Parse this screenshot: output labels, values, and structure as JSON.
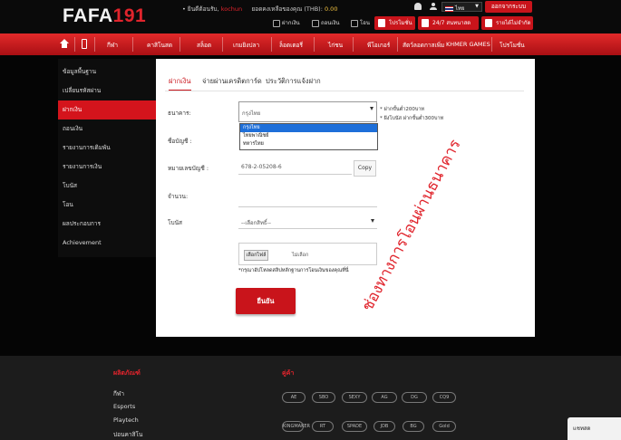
{
  "header": {
    "logo_white": "FAFA",
    "logo_red": "191",
    "welcome_prefix": "• ยินดีต้อนรับ,",
    "username": "kochun",
    "balance_label": "ยอดคงเหลือของคุณ (THB):",
    "balance_value": "0.00",
    "links": {
      "deposit": "ฝากเงิน",
      "withdraw": "ถอนเงิน",
      "transfer": "โอน"
    },
    "language": "ไทย",
    "logout": "ออกจากระบบ",
    "btn_promo": "โปรโมชั่น",
    "btn_support": "24/7 สนทนาสด",
    "btn_affiliate": "รายได้ไม่จำกัด"
  },
  "nav": {
    "home_icon": "home-icon",
    "mobile_icon": "mobile-icon",
    "items": [
      "กีฬา",
      "คาสิโนสด",
      "สล็อต",
      "เกมยิงปลา",
      "ล็อตเตอรี่",
      "ไก่ชน",
      "พีโอเกอร์",
      "สัตว์ลอดกาสเพิ่ม",
      "KHMER GAMES",
      "โปรโมชั่น"
    ]
  },
  "sidebar": {
    "items": [
      "ข้อมูลพื้นฐาน",
      "เปลี่ยนรหัสผ่าน",
      "ฝากเงิน",
      "ถอนเงิน",
      "รายงานการเดิมพัน",
      "รายงานการเงิน",
      "โบนัส",
      "โอน",
      "ผลประกอบการ",
      "Achievement"
    ],
    "active_index": 2
  },
  "deposit": {
    "tabs": [
      "ฝากเงิน",
      "จ่ายผ่านเครดิตการ์ด",
      "ประวัติการแจ้งฝาก"
    ],
    "bank_label": "ธนาคาร:",
    "bank_value": "กรุงไทย",
    "bank_options": [
      "กรุงไทย",
      "ไทยพาณิชย์",
      "ทหารไทย"
    ],
    "bank_selected_index": 0,
    "min_note": "* ฝากขั้นต่ำ200บาท",
    "time_note": "* ฝังโบนัส ฝากขั้นต่ำ300บาท",
    "account_name_label": "ชื่อบัญชี :",
    "account_no_label": "หมายเลขบัญชี :",
    "account_no": "678-2-05208-6",
    "copy": "Copy",
    "amount_label": "จำนวน:",
    "bonus_label": "โบนัส",
    "bonus_placeholder": "--เลือกสิทธิ์--",
    "upload_button": "เลือกไฟล์",
    "upload_text": "ไม่เลือก",
    "hint": "*กรุณาอัปโหลดสลิปหลักฐานการโอนเงินของคุณที่นี่",
    "submit": "ยืนยัน",
    "overlay_text": "ช่องทางการโอนผ่านธนาคาร"
  },
  "footer": {
    "products_heading": "ผลิตภัณฑ์",
    "partners_heading": "คู่ค้า",
    "products": [
      "กีฬา",
      "Esports",
      "Playtech",
      "บ่อนคาสิโน"
    ],
    "partners_row1": [
      "AE",
      "SBO",
      "SEXY",
      "AG",
      "DG",
      "CQ9"
    ],
    "partners_row2": [
      "KINGMAKER",
      "RT",
      "SPADE",
      "JDB",
      "BG",
      "Gold"
    ]
  },
  "chat": {
    "label": "แชทสด"
  },
  "colors": {
    "accent": "#c9141b",
    "background": "#050505",
    "panel": "#ffffff"
  }
}
